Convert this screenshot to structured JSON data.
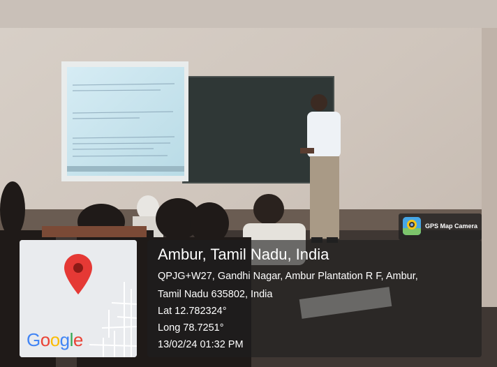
{
  "badge": {
    "icon": "map-camera-icon",
    "label": "GPS Map Camera"
  },
  "location": {
    "title": "Ambur, Tamil Nadu, India",
    "address_line1": "QPJG+W27, Gandhi Nagar, Ambur Plantation R F, Ambur,",
    "address_line2": "Tamil Nadu 635802, India",
    "latitude": "Lat 12.782324°",
    "longitude": "Long 78.7251°",
    "datetime": "13/02/24 01:32 PM"
  },
  "map": {
    "marker_icon": "location-pin-icon",
    "logo_letters": [
      "G",
      "o",
      "o",
      "g",
      "l",
      "e"
    ],
    "logo_colors": [
      "#4285F4",
      "#EA4335",
      "#FBBC05",
      "#4285F4",
      "#34A853",
      "#EA4335"
    ],
    "pin_color": "#E53935"
  }
}
